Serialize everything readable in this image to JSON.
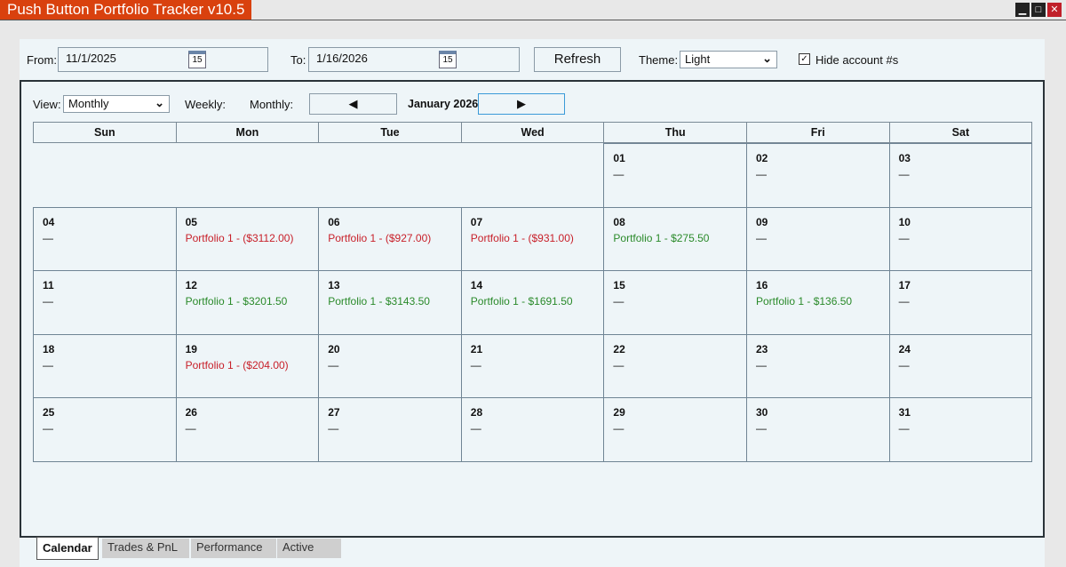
{
  "window": {
    "title": "Push Button Portfolio Tracker v10.5",
    "minimize": "▁",
    "maximize": "□",
    "close": "✕"
  },
  "toolbar": {
    "from_label": "From:",
    "from_value": "11/1/2025",
    "to_label": "To:",
    "to_value": "1/16/2026",
    "calendar_icon": "15",
    "refresh": "Refresh",
    "theme_label": "Theme:",
    "theme_value": "Light",
    "hide_accounts": "Hide account #s",
    "hide_checked": true
  },
  "calendar": {
    "view_label": "View:",
    "view_value": "Monthly",
    "weekly_label": "Weekly:",
    "monthly_label": "Monthly:",
    "prev": "◀",
    "next": "▶",
    "month": "January 2026",
    "weekdays": [
      "Sun",
      "Mon",
      "Tue",
      "Wed",
      "Thu",
      "Fri",
      "Sat"
    ],
    "weeks": [
      [
        null,
        null,
        null,
        null,
        {
          "day": "01",
          "text": "—"
        },
        {
          "day": "02",
          "text": "—"
        },
        {
          "day": "03",
          "text": "—"
        }
      ],
      [
        {
          "day": "04",
          "text": "—"
        },
        {
          "day": "05",
          "text": "Portfolio 1 - ($3112.00)",
          "status": "neg"
        },
        {
          "day": "06",
          "text": "Portfolio 1 - ($927.00)",
          "status": "neg"
        },
        {
          "day": "07",
          "text": "Portfolio 1 - ($931.00)",
          "status": "neg"
        },
        {
          "day": "08",
          "text": "Portfolio 1 - $275.50",
          "status": "pos"
        },
        {
          "day": "09",
          "text": "—"
        },
        {
          "day": "10",
          "text": "—"
        }
      ],
      [
        {
          "day": "11",
          "text": "—"
        },
        {
          "day": "12",
          "text": "Portfolio 1 - $3201.50",
          "status": "pos"
        },
        {
          "day": "13",
          "text": "Portfolio 1 - $3143.50",
          "status": "pos"
        },
        {
          "day": "14",
          "text": "Portfolio 1 - $1691.50",
          "status": "pos"
        },
        {
          "day": "15",
          "text": "—"
        },
        {
          "day": "16",
          "text": "Portfolio 1 - $136.50",
          "status": "pos"
        },
        {
          "day": "17",
          "text": "—"
        }
      ],
      [
        {
          "day": "18",
          "text": "—"
        },
        {
          "day": "19",
          "text": "Portfolio 1 - ($204.00)",
          "status": "neg"
        },
        {
          "day": "20",
          "text": "—"
        },
        {
          "day": "21",
          "text": "—"
        },
        {
          "day": "22",
          "text": "—"
        },
        {
          "day": "23",
          "text": "—"
        },
        {
          "day": "24",
          "text": "—"
        }
      ],
      [
        {
          "day": "25",
          "text": "—"
        },
        {
          "day": "26",
          "text": "—"
        },
        {
          "day": "27",
          "text": "—"
        },
        {
          "day": "28",
          "text": "—"
        },
        {
          "day": "29",
          "text": "—"
        },
        {
          "day": "30",
          "text": "—"
        },
        {
          "day": "31",
          "text": "—"
        }
      ]
    ]
  },
  "tabs": [
    "Calendar",
    "Trades & PnL",
    "Performance",
    "Active"
  ],
  "colors": {
    "title_bar": "#d9410e",
    "negative": "#c8202a",
    "positive": "#2a8a2a"
  }
}
